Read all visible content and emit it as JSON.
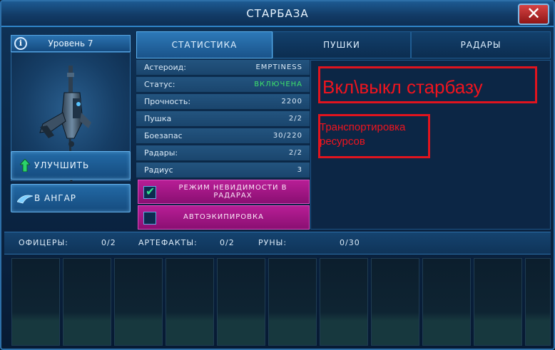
{
  "window": {
    "title": "СТАРБАЗА",
    "close_glyph": "✕"
  },
  "left": {
    "info_glyph": "i",
    "level_label": "Уровень 7",
    "buttons": [
      {
        "label": "УЛУЧШИТЬ",
        "icon": "upgrade-arrow-icon"
      },
      {
        "label": "В АНГАР",
        "icon": "hangar-ship-icon"
      }
    ]
  },
  "tabs": [
    {
      "label": "СТАТИСТИКА",
      "active": true
    },
    {
      "label": "ПУШКИ",
      "active": false
    },
    {
      "label": "РАДАРЫ",
      "active": false
    }
  ],
  "stats": [
    {
      "key": "Астероид:",
      "value": "EMPTINESS"
    },
    {
      "key": "Статус:",
      "value": "ВКЛЮЧЕНА"
    },
    {
      "key": "Прочность:",
      "value": "2200"
    },
    {
      "key": "Пушка",
      "value": "2/2"
    },
    {
      "key": "Боезапас",
      "value": "30/220"
    },
    {
      "key": "Радары:",
      "value": "2/2"
    },
    {
      "key": "Радиус",
      "value": "3"
    }
  ],
  "toggles": [
    {
      "label_line1": "РЕЖИМ НЕВИДИМОСТИ В",
      "label_line2": "РАДАРАХ",
      "checked": true,
      "checkmark": "✔"
    },
    {
      "label": "АВТОЭКИПИРОВКА",
      "checked": false
    }
  ],
  "annotations": {
    "main": "Вкл\\выкл старбазу",
    "transport_line1": "Транспортировка",
    "transport_line2": "ресурсов"
  },
  "resources": {
    "officers_label": "ОФИЦЕРЫ:",
    "officers_value": "0/2",
    "artifacts_label": "АРТЕФАКТЫ:",
    "artifacts_value": "0/2",
    "runes_label": "РУНЫ:",
    "runes_value": "0/30"
  },
  "colors": {
    "status_on": "#3ee06a",
    "accent": "#2d79b8",
    "toggle_bg": "#b81e96",
    "annotation": "#e0141e"
  }
}
